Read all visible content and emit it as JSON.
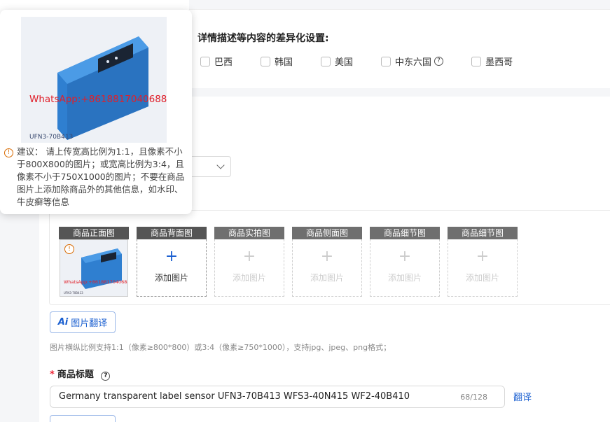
{
  "region": {
    "title": "详情描述等内容的差异化设置:",
    "options": [
      {
        "label": "巴西",
        "checked": false
      },
      {
        "label": "韩国",
        "checked": false
      },
      {
        "label": "美国",
        "checked": false
      },
      {
        "label": "中东六国",
        "checked": false,
        "has_help": true
      },
      {
        "label": "墨西哥",
        "checked": false
      }
    ]
  },
  "images": {
    "slots": [
      {
        "label": "商品正面图",
        "add_label": "",
        "filled": true
      },
      {
        "label": "商品背面图",
        "add_label": "添加图片",
        "filled": false,
        "active": true
      },
      {
        "label": "商品实拍图",
        "add_label": "添加图片",
        "filled": false
      },
      {
        "label": "商品侧面图",
        "add_label": "添加图片",
        "filled": false
      },
      {
        "label": "商品细节图",
        "add_label": "添加图片",
        "filled": false
      },
      {
        "label": "商品细节图",
        "add_label": "添加图片",
        "filled": false
      }
    ],
    "translate_button": "图片翻译",
    "hint": "图片横纵比例支持1:1（像素≥800*800）或3:4（像素≥750*1000），支持jpg、jpeg、png格式；"
  },
  "product_image": {
    "watermark": "WhatsApp:+8618817040688",
    "model_text": "UFN3-70B413",
    "sub_text": "UF"
  },
  "popover": {
    "advice": "建议： 请上传宽高比例为1:1，且像素不小于800X800的图片；或宽高比例为3:4，且像素不小于750X1000的图片；不要在商品图片上添加除商品外的其他信息，如水印、牛皮癣等信息"
  },
  "title_field": {
    "label": "商品标题",
    "value": "Germany  transparent label sensor UFN3-70B413 WFS3-40N415 WF2-40B410",
    "counter": "68/128",
    "translate_link": "翻译"
  },
  "colors": {
    "accent": "#1a5fd0",
    "required": "#e23333",
    "warning": "#d86a00",
    "watermark": "#e0202a",
    "product_blue": "#2f7fd0"
  },
  "icons": [
    "help-circle-icon",
    "chevron-down-icon",
    "plus-icon",
    "warning-icon",
    "ai-icon"
  ]
}
